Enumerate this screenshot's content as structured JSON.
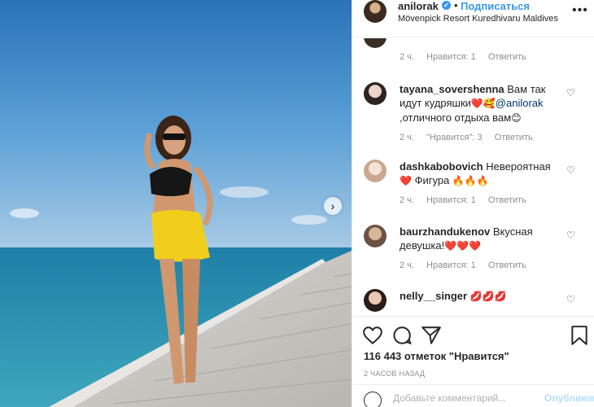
{
  "post": {
    "author": "anilorak",
    "follow_label": "Подписаться",
    "dot": "•",
    "location": "Mövenpick Resort Kuredhivaru Maldives",
    "more_icon": "more-horizontal-icon",
    "photo_description_icon": "photo-next-arrow-icon"
  },
  "comments": [
    {
      "user": "",
      "text_parts": [
        "😊😊"
      ],
      "time": "2 ч.",
      "likes": "Нравится: 1",
      "reply": "Ответить"
    },
    {
      "user": "tayana_sovershenna",
      "text_a": "Вам так идут кудряшки",
      "emoji_a": "❤️🥰",
      "mention": "@anilorak",
      "text_b": ",отличного отдыха вам",
      "emoji_b": "😊",
      "time": "2 ч.",
      "likes": "\"Нравится\": 3",
      "reply": "Ответить"
    },
    {
      "user": "dashkabobovich",
      "text_a": "Невероятная",
      "emoji_a": "❤️",
      "text_b": "Фигура",
      "emoji_b": "🔥🔥🔥",
      "time": "2 ч.",
      "likes": "Нравится: 1",
      "reply": "Ответить"
    },
    {
      "user": "baurzhandukenov",
      "text_a": "Вкусная девушка!",
      "emoji_a": "❤️❤️❤️",
      "time": "2 ч.",
      "likes": "Нравится: 1",
      "reply": "Ответить"
    },
    {
      "user": "nelly__singer",
      "emoji_a": "💋💋💋"
    }
  ],
  "actions": {
    "likes_text": "116 443 отметок \"Нравится\"",
    "time_ago": "2 ЧАСОВ НАЗАД",
    "add_comment_placeholder": "Добавьте комментарий...",
    "publish_label": "Опубликовать"
  },
  "colors": {
    "accent": "#3897f0",
    "muted": "#8e8e8e",
    "text": "#262626"
  }
}
